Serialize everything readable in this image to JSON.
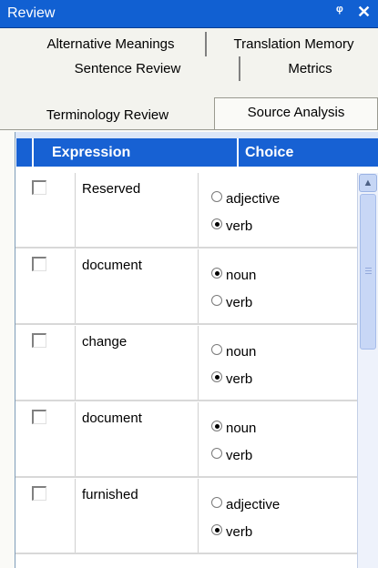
{
  "window": {
    "title": "Review",
    "pin_glyph": "ᵠ",
    "close_glyph": "✕"
  },
  "tabs": {
    "row1": [
      "Alternative Meanings",
      "Translation Memory"
    ],
    "row2": [
      "Sentence Review",
      "Metrics"
    ],
    "row3": [
      "Terminology Review",
      "Source Analysis"
    ],
    "active": "Source Analysis"
  },
  "grid": {
    "columns": [
      "Expression",
      "Choice"
    ],
    "rows": [
      {
        "checked": false,
        "expression": "Reserved",
        "options": [
          "adjective",
          "verb"
        ],
        "selected": "verb"
      },
      {
        "checked": false,
        "expression": "document",
        "options": [
          "noun",
          "verb"
        ],
        "selected": "noun"
      },
      {
        "checked": false,
        "expression": "change",
        "options": [
          "noun",
          "verb"
        ],
        "selected": "verb"
      },
      {
        "checked": false,
        "expression": "document",
        "options": [
          "noun",
          "verb"
        ],
        "selected": "noun"
      },
      {
        "checked": false,
        "expression": "furnished",
        "options": [
          "adjective",
          "verb"
        ],
        "selected": "verb"
      }
    ]
  },
  "scrollbar": {
    "up_arrow": "▲"
  }
}
